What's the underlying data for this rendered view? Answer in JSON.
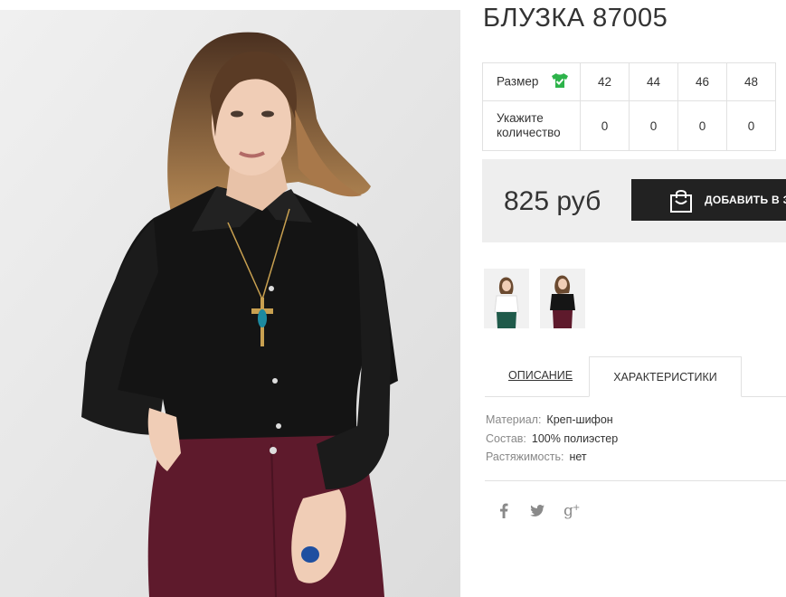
{
  "product": {
    "title": "БЛУЗКА 87005",
    "price": "825 руб",
    "add_to_cart_label": "ДОБАВИТЬ В З"
  },
  "size_table": {
    "size_label": "Размер",
    "qty_label_line1": "Укажите",
    "qty_label_line2": "количество",
    "sizes": [
      "42",
      "44",
      "46",
      "48"
    ],
    "quantities": [
      "0",
      "0",
      "0",
      "0"
    ],
    "size_icon": "tshirt-check-icon"
  },
  "tabs": {
    "description": "ОПИСАНИЕ",
    "characteristics": "ХАРАКТЕРИСТИКИ",
    "active": "characteristics"
  },
  "specs": [
    {
      "key": "Материал:",
      "value": "Креп-шифон"
    },
    {
      "key": "Состав:",
      "value": "100% полиэстер"
    },
    {
      "key": "Растяжимость:",
      "value": "нет"
    }
  ],
  "social": [
    "facebook-icon",
    "twitter-icon",
    "google-plus-icon"
  ],
  "colors": {
    "accent_green": "#2db34a",
    "button_dark": "#222222",
    "price_bg": "#eeeeee",
    "blouse": "#141414",
    "trousers": "#5e1a2c"
  }
}
